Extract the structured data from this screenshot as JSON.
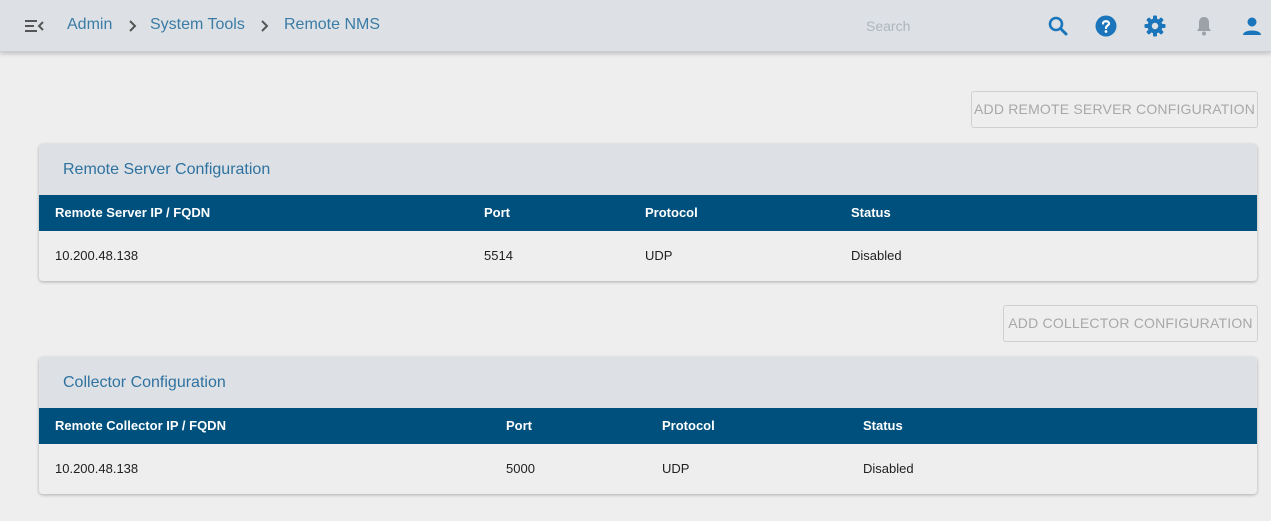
{
  "header": {
    "breadcrumb": [
      "Admin",
      "System Tools",
      "Remote NMS"
    ],
    "search_placeholder": "Search",
    "icons": [
      "menu-collapse-icon",
      "search-icon",
      "help-icon",
      "gear-icon",
      "bell-icon",
      "account-icon"
    ]
  },
  "remote_server": {
    "add_button_label": "ADD REMOTE SERVER CONFIGURATION",
    "title": "Remote Server Configuration",
    "columns": [
      "Remote Server IP / FQDN",
      "Port",
      "Protocol",
      "Status"
    ],
    "rows": [
      {
        "ip": "10.200.48.138",
        "port": "5514",
        "protocol": "UDP",
        "status": "Disabled"
      }
    ]
  },
  "collector": {
    "add_button_label": "ADD COLLECTOR CONFIGURATION",
    "title": "Collector Configuration",
    "columns": [
      "Remote Collector IP / FQDN",
      "Port",
      "Protocol",
      "Status"
    ],
    "rows": [
      {
        "ip": "10.200.48.138",
        "port": "5000",
        "protocol": "UDP",
        "status": "Disabled"
      }
    ]
  },
  "colors": {
    "accent": "#00507e",
    "link": "#3a7ca5",
    "icon": "#1b75bb",
    "header_bg": "#dde1e5"
  }
}
